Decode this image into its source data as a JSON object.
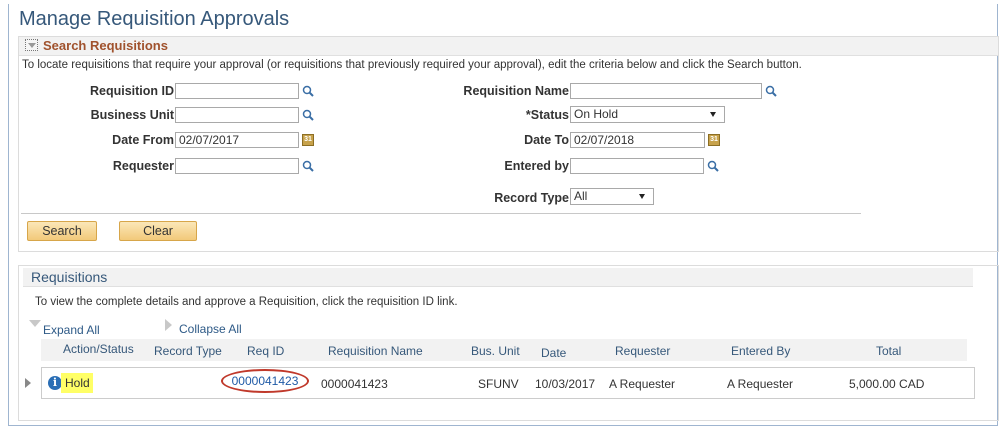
{
  "page": {
    "title": "Manage Requisition Approvals"
  },
  "search": {
    "header": "Search Requisitions",
    "instructions": "To locate requisitions that require your approval (or requisitions that previously required your approval), edit the criteria below and click the Search button.",
    "fields": {
      "requisition_id": {
        "label": "Requisition ID",
        "value": ""
      },
      "business_unit": {
        "label": "Business Unit",
        "value": ""
      },
      "date_from": {
        "label": "Date From",
        "value": "02/07/2017"
      },
      "requester": {
        "label": "Requester",
        "value": ""
      },
      "requisition_name": {
        "label": "Requisition Name",
        "value": ""
      },
      "status": {
        "label": "*Status",
        "value": "On Hold"
      },
      "date_to": {
        "label": "Date To",
        "value": "02/07/2018"
      },
      "entered_by": {
        "label": "Entered by",
        "value": ""
      },
      "record_type": {
        "label": "Record Type",
        "value": "All"
      }
    },
    "buttons": {
      "search": "Search",
      "clear": "Clear"
    }
  },
  "requisitions": {
    "header": "Requisitions",
    "instructions": "To view the complete details and approve a Requisition, click the requisition ID link.",
    "expand_all": "Expand All",
    "collapse_all": "Collapse All",
    "columns": [
      "Action/Status",
      "Record Type",
      "Req ID",
      "Requisition Name",
      "Bus. Unit",
      "Date",
      "Requester",
      "Entered By",
      "Total"
    ],
    "rows": [
      {
        "action_status": "Hold",
        "record_type": "",
        "req_id": "0000041423",
        "requisition_name": "0000041423",
        "bus_unit": "SFUNV",
        "date": "10/03/2017",
        "requester": "A Requester",
        "entered_by": "A Requester",
        "total": "5,000.00 CAD"
      }
    ]
  },
  "icons": {
    "search": "magnifier-icon",
    "calendar": "calendar-icon",
    "info": "info-icon",
    "colors": {
      "accent": "#36587a",
      "section_header": "#a0522d",
      "hold_highlight": "#ffff66",
      "circle": "#c0392b",
      "link": "#1f5aa6"
    }
  }
}
